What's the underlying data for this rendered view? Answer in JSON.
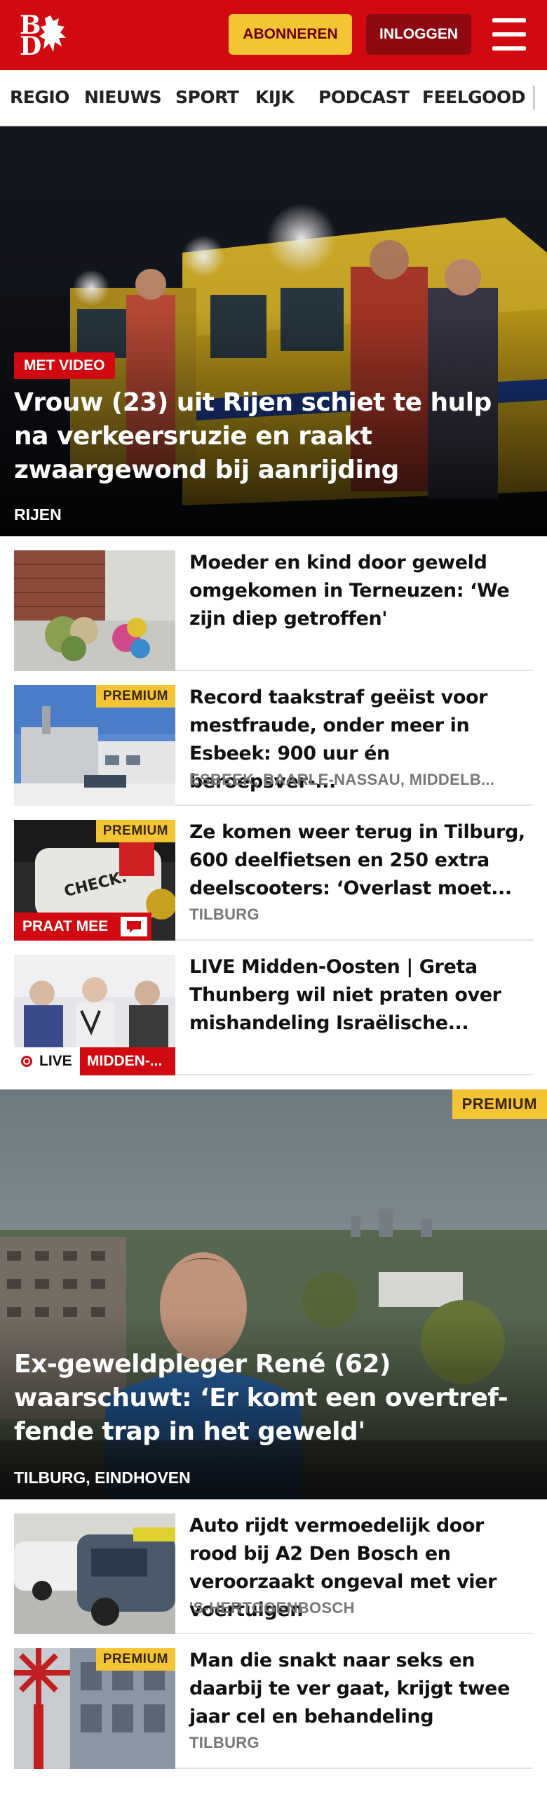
{
  "header": {
    "logo_letters": [
      "B",
      "D"
    ],
    "subscribe_label": "ABONNEREN",
    "login_label": "INLOGGEN",
    "brand_color": "#d10a11",
    "subscribe_color": "#f3c534"
  },
  "nav": {
    "items": [
      "REGIO",
      "NIEUWS",
      "SPORT",
      "KIJK",
      "PODCAST",
      "FEELGOOD"
    ]
  },
  "hero1": {
    "tag": "MET VIDEO",
    "title": "Vrouw (23) uit Rijen schiet te hulp na verkeersruzie en raakt zwaargewond bij aanrijding",
    "location": "RIJEN"
  },
  "articles": [
    {
      "title": "Moeder en kind door geweld omgekomen in Terneuzen: ‘We zijn diep getroffen'",
      "location": ""
    },
    {
      "badge": "PREMIUM",
      "title": "Record taakstraf geëist voor mestfraude, onder meer in Esbeek: 900 uur én beroepsver-...",
      "location": "ESBEEK, BAARLE-NASSAU, MIDDELB..."
    },
    {
      "badge": "PREMIUM",
      "overlay": "PRAAT MEE",
      "title": "Ze komen weer terug in Tilburg, 600 deelfietsen en 250 extra deelscooters: ‘Overlast moet...",
      "location": "TILBURG"
    },
    {
      "live_label": "LIVE",
      "live_topic": "MIDDEN-...",
      "title": "LIVE Midden-Oosten | Greta Thunberg wil niet praten over mishandeling Israëlische...",
      "location": ""
    }
  ],
  "hero2": {
    "badge": "PREMIUM",
    "title": "Ex-geweldpleger René (62) waarschuwt: ‘Er komt een overtref-fende trap in het geweld'",
    "location": "TILBURG, EINDHOVEN"
  },
  "articles2": [
    {
      "title": "Auto rijdt vermoedelijk door rood bij A2 Den Bosch en veroorzaakt ongeval met vier voertuigen",
      "location": "'S-HERTOGENBOSCH"
    },
    {
      "badge": "PREMIUM",
      "title": "Man die snakt naar seks en daarbij te ver gaat, krijgt twee jaar cel en behandeling",
      "location": "TILBURG"
    }
  ]
}
